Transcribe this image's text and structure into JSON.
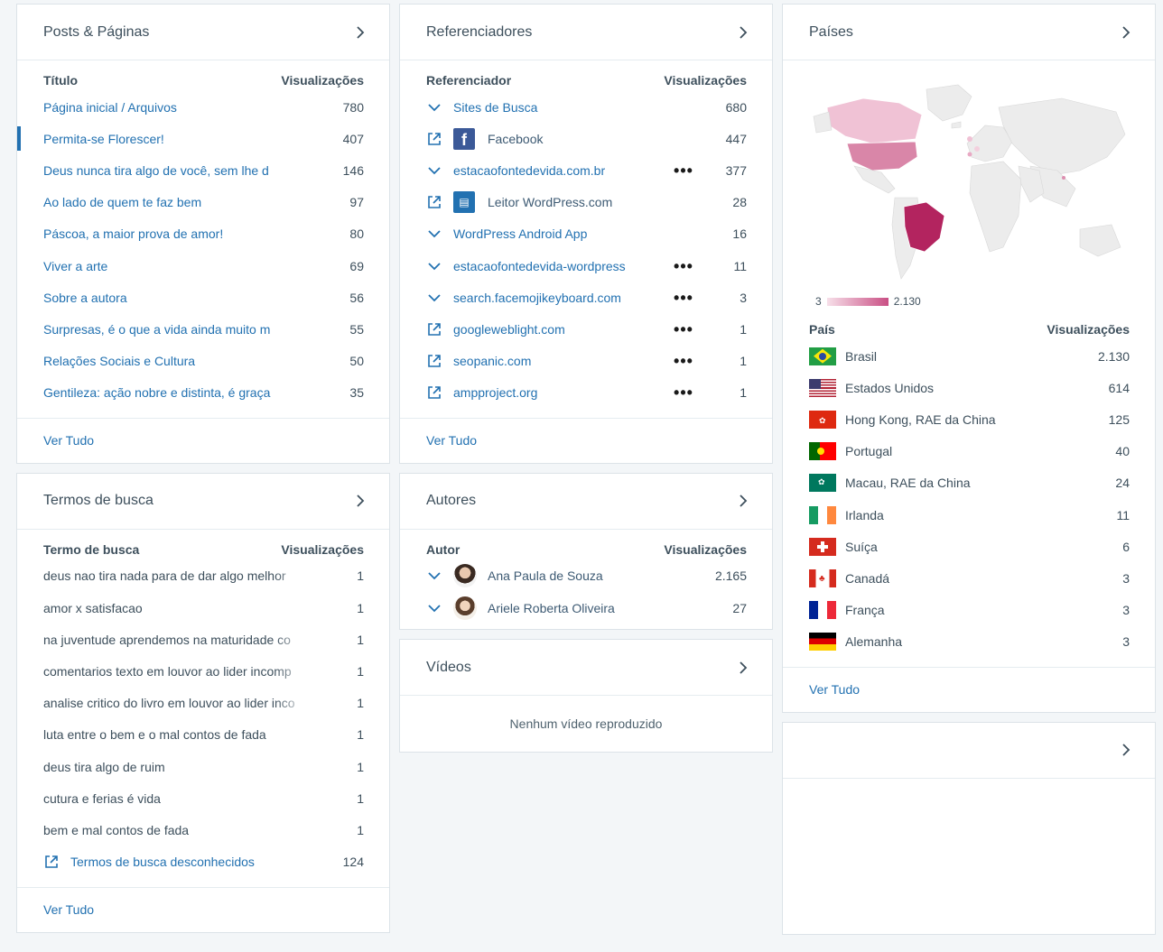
{
  "posts": {
    "title": "Posts & Páginas",
    "col_title": "Título",
    "col_views": "Visualizações",
    "rows": [
      {
        "label": "Página inicial / Arquivos",
        "value": "780"
      },
      {
        "label": "Permita-se Florescer!",
        "value": "407"
      },
      {
        "label": "Deus nunca tira algo de você, sem lhe d",
        "value": "146"
      },
      {
        "label": "Ao lado de quem te faz bem",
        "value": "97"
      },
      {
        "label": "Páscoa, a maior prova de amor!",
        "value": "80"
      },
      {
        "label": "Viver a arte",
        "value": "69"
      },
      {
        "label": "Sobre a autora",
        "value": "56"
      },
      {
        "label": "Surpresas, é o que a vida ainda muito m",
        "value": "55"
      },
      {
        "label": "Relações Sociais e Cultura",
        "value": "50"
      },
      {
        "label": "Gentileza: ação nobre e distinta, é graça",
        "value": "35"
      }
    ],
    "footer": "Ver Tudo"
  },
  "search": {
    "title": "Termos de busca",
    "col_title": "Termo de busca",
    "col_views": "Visualizações",
    "rows": [
      {
        "label": "deus nao tira nada para de dar algo melhor",
        "value": "1"
      },
      {
        "label": "amor x satisfacao",
        "value": "1"
      },
      {
        "label": "na juventude aprendemos na maturidade co",
        "value": "1"
      },
      {
        "label": "comentarios texto em louvor ao lider incomp",
        "value": "1"
      },
      {
        "label": "analise critico do livro em louvor ao lider inco",
        "value": "1"
      },
      {
        "label": "luta entre o bem e o mal contos de fada",
        "value": "1"
      },
      {
        "label": "deus tira algo de ruim",
        "value": "1"
      },
      {
        "label": "cutura e ferias é vida",
        "value": "1"
      },
      {
        "label": "bem e mal contos de fada",
        "value": "1"
      },
      {
        "label": "Termos de busca desconhecidos",
        "value": "124"
      }
    ],
    "footer": "Ver Tudo"
  },
  "referrers": {
    "title": "Referenciadores",
    "col_title": "Referenciador",
    "col_views": "Visualizações",
    "rows": [
      {
        "label": "Sites de Busca",
        "value": "680"
      },
      {
        "label": "Facebook",
        "value": "447"
      },
      {
        "label": "estacaofontedevida.com.br",
        "value": "377"
      },
      {
        "label": "Leitor WordPress.com",
        "value": "28"
      },
      {
        "label": "WordPress Android App",
        "value": "16"
      },
      {
        "label": "estacaofontedevida-wordpress",
        "value": "11"
      },
      {
        "label": "search.facemojikeyboard.com",
        "value": "3"
      },
      {
        "label": "googleweblight.com",
        "value": "1"
      },
      {
        "label": "seopanic.com",
        "value": "1"
      },
      {
        "label": "ampproject.org",
        "value": "1"
      }
    ],
    "dots": "•••",
    "fb_letter": "f",
    "footer": "Ver Tudo"
  },
  "authors": {
    "title": "Autores",
    "col_title": "Autor",
    "col_views": "Visualizações",
    "rows": [
      {
        "label": "Ana Paula de Souza",
        "value": "2.165"
      },
      {
        "label": "Ariele Roberta Oliveira",
        "value": "27"
      }
    ]
  },
  "videos": {
    "title": "Vídeos",
    "empty": "Nenhum vídeo reproduzido"
  },
  "countries": {
    "title": "Países",
    "legend_min": "3",
    "legend_max": "2.130",
    "col_title": "País",
    "col_views": "Visualizações",
    "rows": [
      {
        "label": "Brasil",
        "value": "2.130"
      },
      {
        "label": "Estados Unidos",
        "value": "614"
      },
      {
        "label": "Hong Kong, RAE da China",
        "value": "125"
      },
      {
        "label": "Portugal",
        "value": "40"
      },
      {
        "label": "Macau, RAE da China",
        "value": "24"
      },
      {
        "label": "Irlanda",
        "value": "11"
      },
      {
        "label": "Suíça",
        "value": "6"
      },
      {
        "label": "Canadá",
        "value": "3"
      },
      {
        "label": "França",
        "value": "3"
      },
      {
        "label": "Alemanha",
        "value": "3"
      }
    ],
    "footer": "Ver Tudo"
  },
  "colors": {
    "link": "#2271b1",
    "accent_bar": "#2271b1",
    "map_high": "#c94f84",
    "map_low": "#f7dfe9"
  }
}
